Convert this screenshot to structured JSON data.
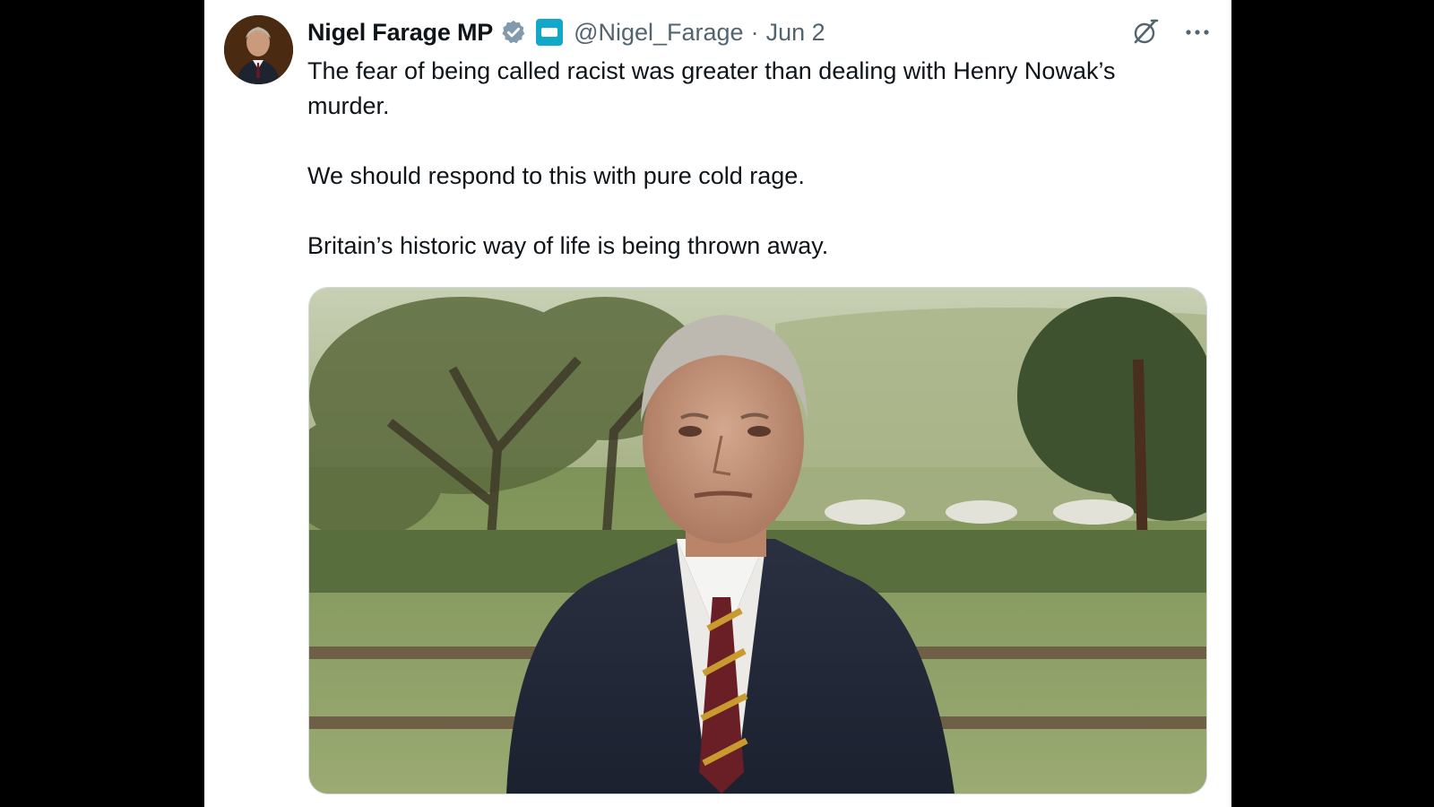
{
  "tweet": {
    "author": {
      "display_name": "Nigel Farage MP",
      "handle": "@Nigel_Farage",
      "verified": true,
      "verified_icon": "verified-badge-icon",
      "affiliate_icon": "reform-affiliate-badge-icon"
    },
    "separator": "·",
    "date": "Jun 2",
    "actions": {
      "grok_icon": "grok-icon",
      "more_icon": "more-horizontal-icon"
    },
    "paragraphs": [
      "The fear of being called racist was greater than dealing with Henry Nowak’s murder.",
      "We should respond to this with pure cold rage.",
      "Britain’s historic way of life is being thrown away."
    ],
    "media": {
      "type": "video-thumbnail"
    }
  },
  "colors": {
    "page_background": "#000000",
    "card_background": "#ffffff",
    "primary_text": "#0f1419",
    "secondary_text": "#536471",
    "verified_blue": "#829aab",
    "affiliate_teal": "#12a8c9"
  }
}
